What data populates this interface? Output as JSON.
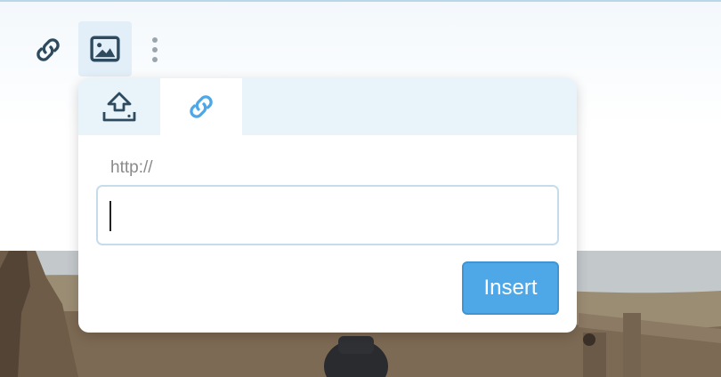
{
  "toolbar": {
    "buttons": [
      {
        "name": "link",
        "icon": "link-icon"
      },
      {
        "name": "image",
        "icon": "image-icon",
        "active": true
      },
      {
        "name": "more",
        "icon": "more-vertical-icon"
      }
    ]
  },
  "popover": {
    "tabs": [
      {
        "name": "upload",
        "icon": "upload-icon",
        "active": false
      },
      {
        "name": "link",
        "icon": "link-icon",
        "active": true
      }
    ],
    "url_label": "http://",
    "url_value": "",
    "insert_label": "Insert"
  },
  "colors": {
    "accent": "#4ea8e8",
    "icon_dark": "#2e4a5e",
    "icon_active": "#4ea8e8",
    "tab_bg": "#e8f3fa"
  }
}
